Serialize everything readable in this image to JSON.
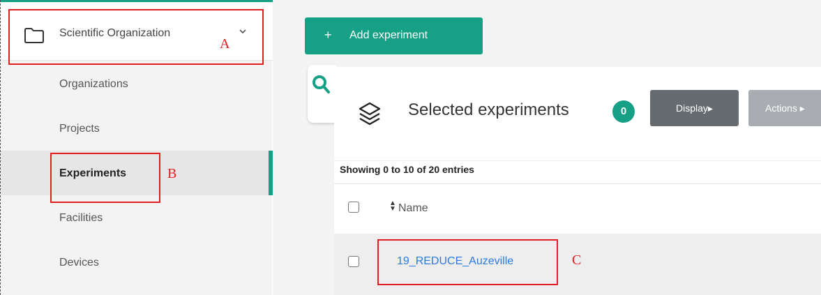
{
  "sidebar": {
    "organization_label": "Scientific Organization",
    "items": [
      {
        "label": "Organizations"
      },
      {
        "label": "Projects"
      },
      {
        "label": "Experiments"
      },
      {
        "label": "Facilities"
      },
      {
        "label": "Devices"
      }
    ],
    "active_item": "Experiments"
  },
  "main": {
    "add_button_plus": "+",
    "add_button_label": "Add experiment",
    "card": {
      "title": "Selected experiments",
      "count": "0",
      "display_label": "Display▸",
      "actions_label": "Actions ▸",
      "entries_info": "Showing 0 to 10 of 20 entries",
      "column_name": "Name",
      "rows": [
        {
          "name": "19_REDUCE_Auzeville"
        }
      ]
    }
  },
  "annotations": {
    "a": "A",
    "b": "B",
    "c": "C"
  },
  "colors": {
    "accent": "#16a085",
    "link": "#2a7ae2",
    "annotation": "#e02020"
  }
}
